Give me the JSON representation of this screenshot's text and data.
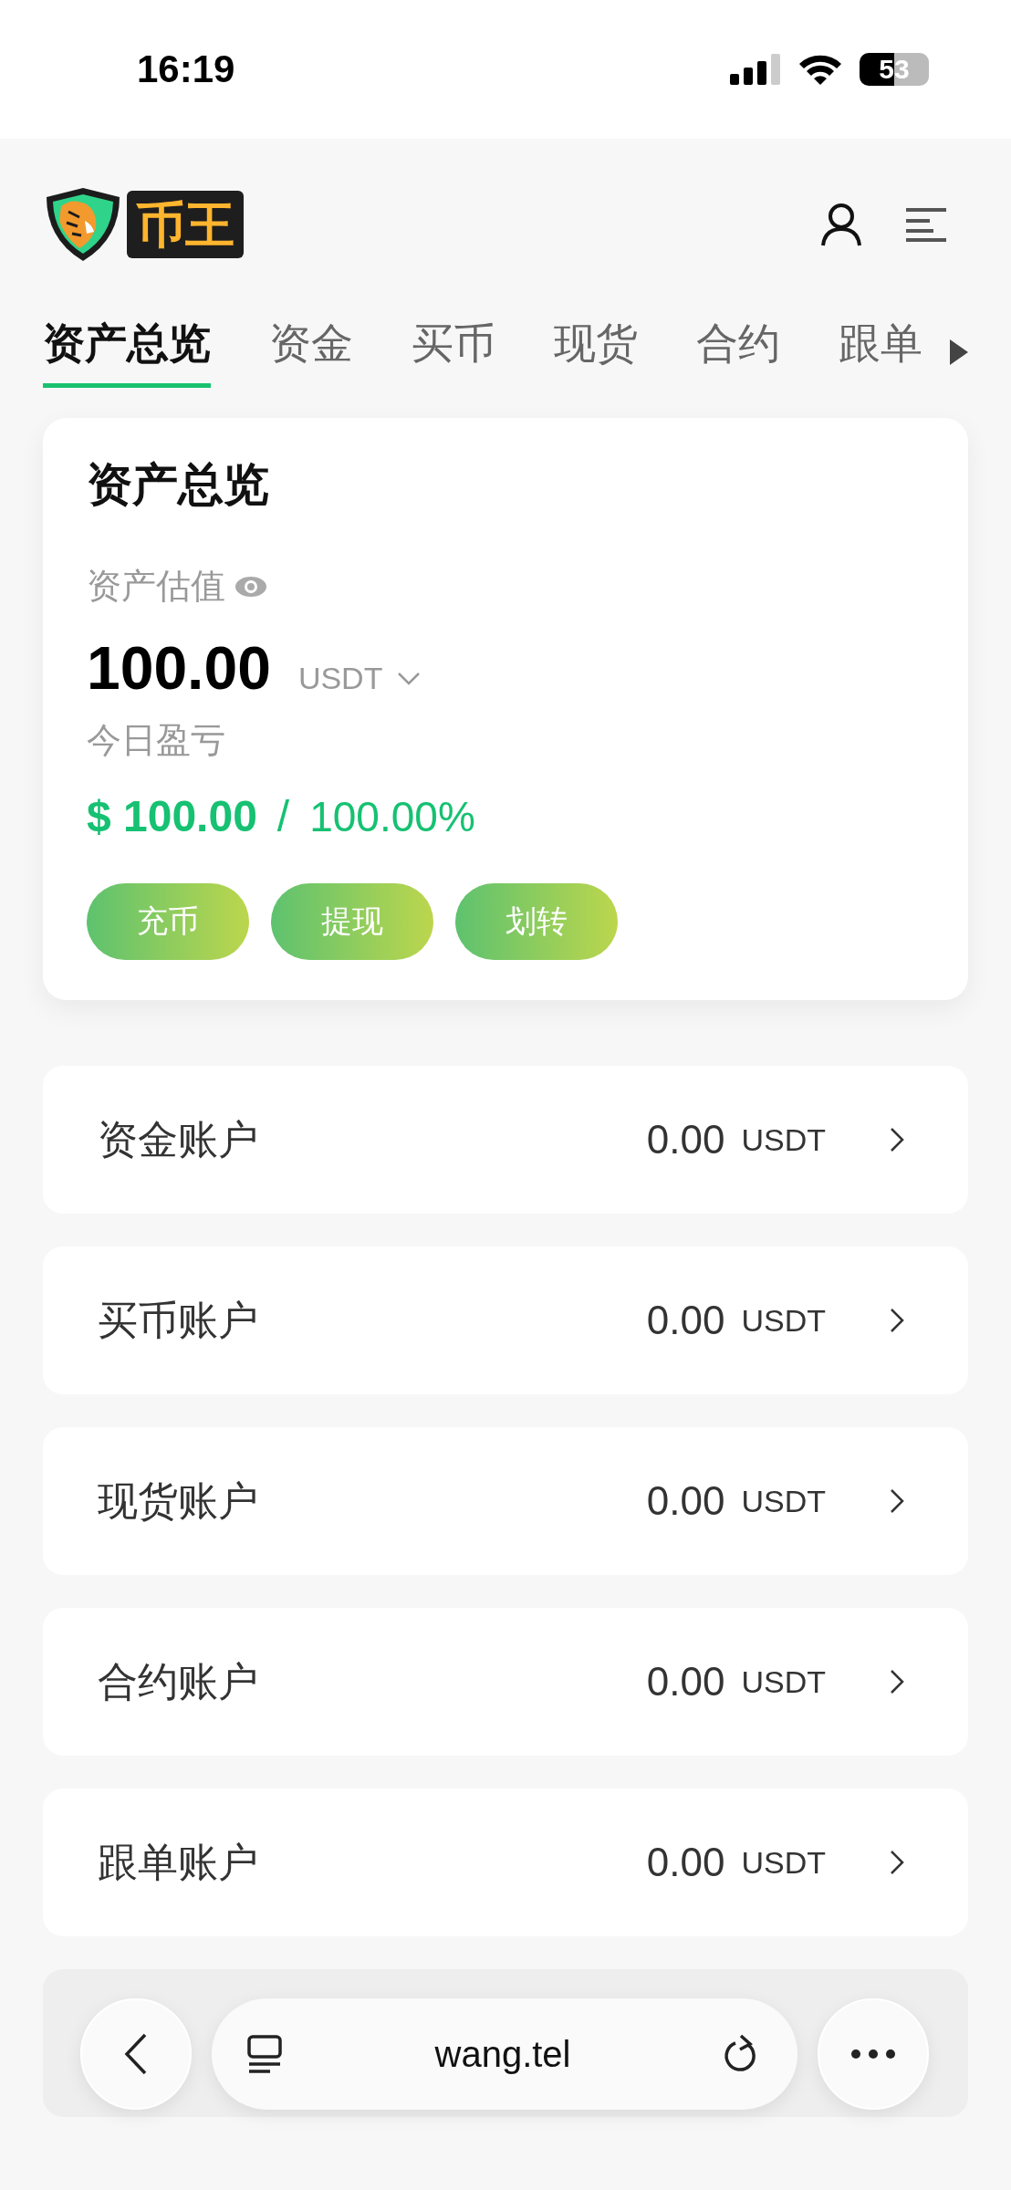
{
  "status_bar": {
    "time": "16:19",
    "battery": "53"
  },
  "header": {
    "logo_text": "币王"
  },
  "tabs": [
    {
      "label": "资产总览",
      "selected": true
    },
    {
      "label": "资金",
      "selected": false
    },
    {
      "label": "买币",
      "selected": false
    },
    {
      "label": "现货",
      "selected": false
    },
    {
      "label": "合约",
      "selected": false
    },
    {
      "label": "跟单",
      "selected": false
    }
  ],
  "overview": {
    "title": "资产总览",
    "valuation_label": "资产估值",
    "amount": "100.00",
    "currency": "USDT",
    "pnl_label": "今日盈亏",
    "pnl_amount": "$ 100.00",
    "pnl_separator": "/",
    "pnl_percent": "100.00%",
    "buttons": [
      "充币",
      "提现",
      "划转"
    ]
  },
  "accounts": [
    {
      "name": "资金账户",
      "balance": "0.00",
      "currency": "USDT"
    },
    {
      "name": "买币账户",
      "balance": "0.00",
      "currency": "USDT"
    },
    {
      "name": "现货账户",
      "balance": "0.00",
      "currency": "USDT"
    },
    {
      "name": "合约账户",
      "balance": "0.00",
      "currency": "USDT"
    },
    {
      "name": "跟单账户",
      "balance": "0.00",
      "currency": "USDT"
    }
  ],
  "browser_bar": {
    "url": "wang.tel"
  }
}
